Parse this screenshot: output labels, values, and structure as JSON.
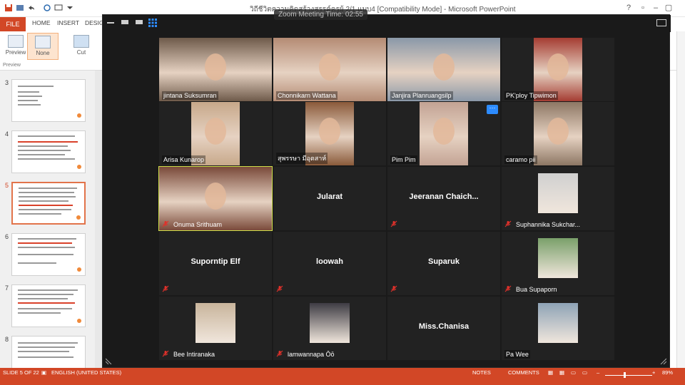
{
  "powerpoint": {
    "doc_title": "วิถีชีวิตความคิดสร้างสรรค์ครูผู้ 2/1 แบบ4 [Compatibility Mode] - Microsoft PowerPoint",
    "tabs": [
      "FILE",
      "HOME",
      "INSERT",
      "DESIGN"
    ],
    "ribbon": {
      "preview_label": "Preview",
      "none_label": "None",
      "cut_label": "Cut",
      "group_label": "Preview"
    },
    "slides": [
      {
        "num": "3"
      },
      {
        "num": "4"
      },
      {
        "num": "5",
        "selected": true
      },
      {
        "num": "6"
      },
      {
        "num": "7"
      },
      {
        "num": "8"
      }
    ],
    "status": {
      "slide_info": "SLIDE 5 OF 22",
      "language": "ENGLISH (UNITED STATES)",
      "notes": "NOTES",
      "comments": "COMMENTS",
      "zoom": "89%"
    },
    "accent_color": "#d24726"
  },
  "zoom_window": {
    "title": "Zoom Meeting  Time: 02:55",
    "participants": [
      {
        "name": "jintana Suksumran",
        "video": true,
        "muted": false,
        "bg": "#6e5a4a"
      },
      {
        "name": "Chonnikarn Wattana",
        "video": true,
        "muted": false,
        "bg": "#b48b74"
      },
      {
        "name": "Janjira Planruangsilp",
        "video": true,
        "muted": false,
        "bg": "#8a98a8"
      },
      {
        "name": "PK'ploy Tipwimon",
        "video": true,
        "muted": false,
        "bg": "#a53c32"
      },
      {
        "name": "Arisa Kunarop",
        "video": true,
        "muted": false,
        "bg": "#c7a88a"
      },
      {
        "name": "สุพรรษา มีอุตสาห์",
        "video": true,
        "muted": false,
        "bg": "#8a5a3a"
      },
      {
        "name": "Pim Pim",
        "video": true,
        "muted": false,
        "bg": "#c3a394",
        "more": true
      },
      {
        "name": "caramo pii",
        "video": true,
        "muted": false,
        "bg": "#8d7764"
      },
      {
        "name": "Onuma Srithuam",
        "video": true,
        "muted": true,
        "bg": "#7a4a3a",
        "active": true
      },
      {
        "name": "Jularat",
        "video": false,
        "muted": false
      },
      {
        "name": "Jeeranan  Chaich...",
        "video": false,
        "muted": true
      },
      {
        "name": "Suphannika Sukchar...",
        "video": "avatar",
        "muted": true,
        "bg": "#d0d0d0"
      },
      {
        "name": "Suporntip Elf",
        "video": false,
        "muted": true
      },
      {
        "name": "loowah",
        "video": false,
        "muted": true
      },
      {
        "name": "Suparuk",
        "video": false,
        "muted": true
      },
      {
        "name": "Bua Supaporn",
        "video": "avatar",
        "muted": true,
        "bg": "#7aa06a"
      },
      {
        "name": "Bee Intiranaka",
        "video": "avatar",
        "muted": true,
        "bg": "#c9b59c"
      },
      {
        "name": "lamwannapa Ōō",
        "video": "avatar",
        "muted": true,
        "bg": "#3e3c44"
      },
      {
        "name": "Miss.Chanisa",
        "video": false,
        "muted": false
      },
      {
        "name": "Pa Wee",
        "video": "avatar",
        "muted": false,
        "bg": "#8ea3b6"
      }
    ]
  }
}
